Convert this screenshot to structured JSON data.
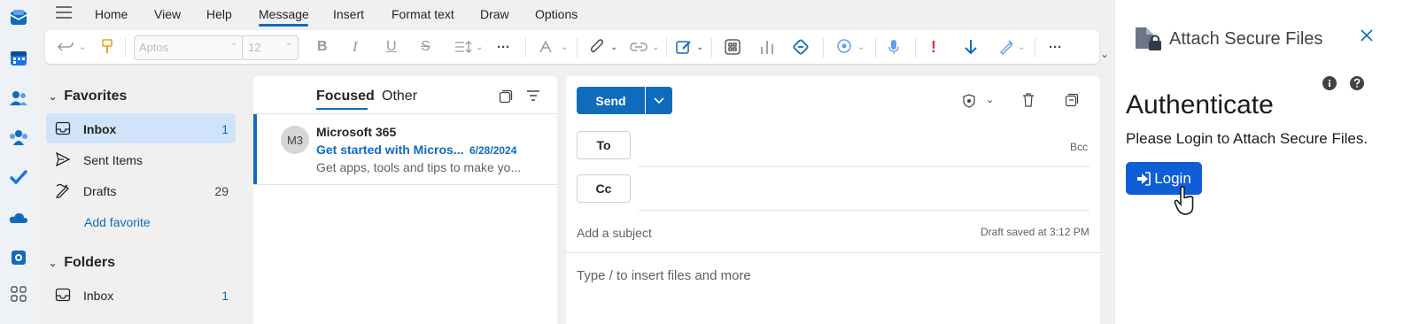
{
  "menu": {
    "items": [
      "Home",
      "View",
      "Help",
      "Message",
      "Insert",
      "Format text",
      "Draw",
      "Options"
    ],
    "active": "Message"
  },
  "ribbon": {
    "font_name": "Aptos",
    "font_size": "12"
  },
  "folders": {
    "favorites_label": "Favorites",
    "favorites": [
      {
        "label": "Inbox",
        "count": "1"
      },
      {
        "label": "Sent Items",
        "count": ""
      },
      {
        "label": "Drafts",
        "count": "29"
      }
    ],
    "add_favorite": "Add favorite",
    "folders_label": "Folders",
    "folders": [
      {
        "label": "Inbox",
        "count": "1"
      }
    ]
  },
  "message_list": {
    "tab_focused": "Focused",
    "tab_other": "Other",
    "items": [
      {
        "avatar": "M3",
        "sender": "Microsoft 365",
        "subject": "Get started with Micros...",
        "date": "6/28/2024",
        "preview": "Get apps, tools and tips to make yo..."
      }
    ]
  },
  "compose": {
    "send_label": "Send",
    "to_label": "To",
    "cc_label": "Cc",
    "bcc_label": "Bcc",
    "subject_placeholder": "Add a subject",
    "draft_status": "Draft saved at 3:12 PM",
    "body_placeholder": "Type / to insert files and more"
  },
  "addin": {
    "title": "Attach Secure Files",
    "heading": "Authenticate",
    "message": "Please Login to Attach Secure Files.",
    "login_label": "Login"
  },
  "colors": {
    "accent": "#0f6cbd",
    "login_button": "#0d5ed7",
    "selected_folder": "#cfe4fa"
  }
}
